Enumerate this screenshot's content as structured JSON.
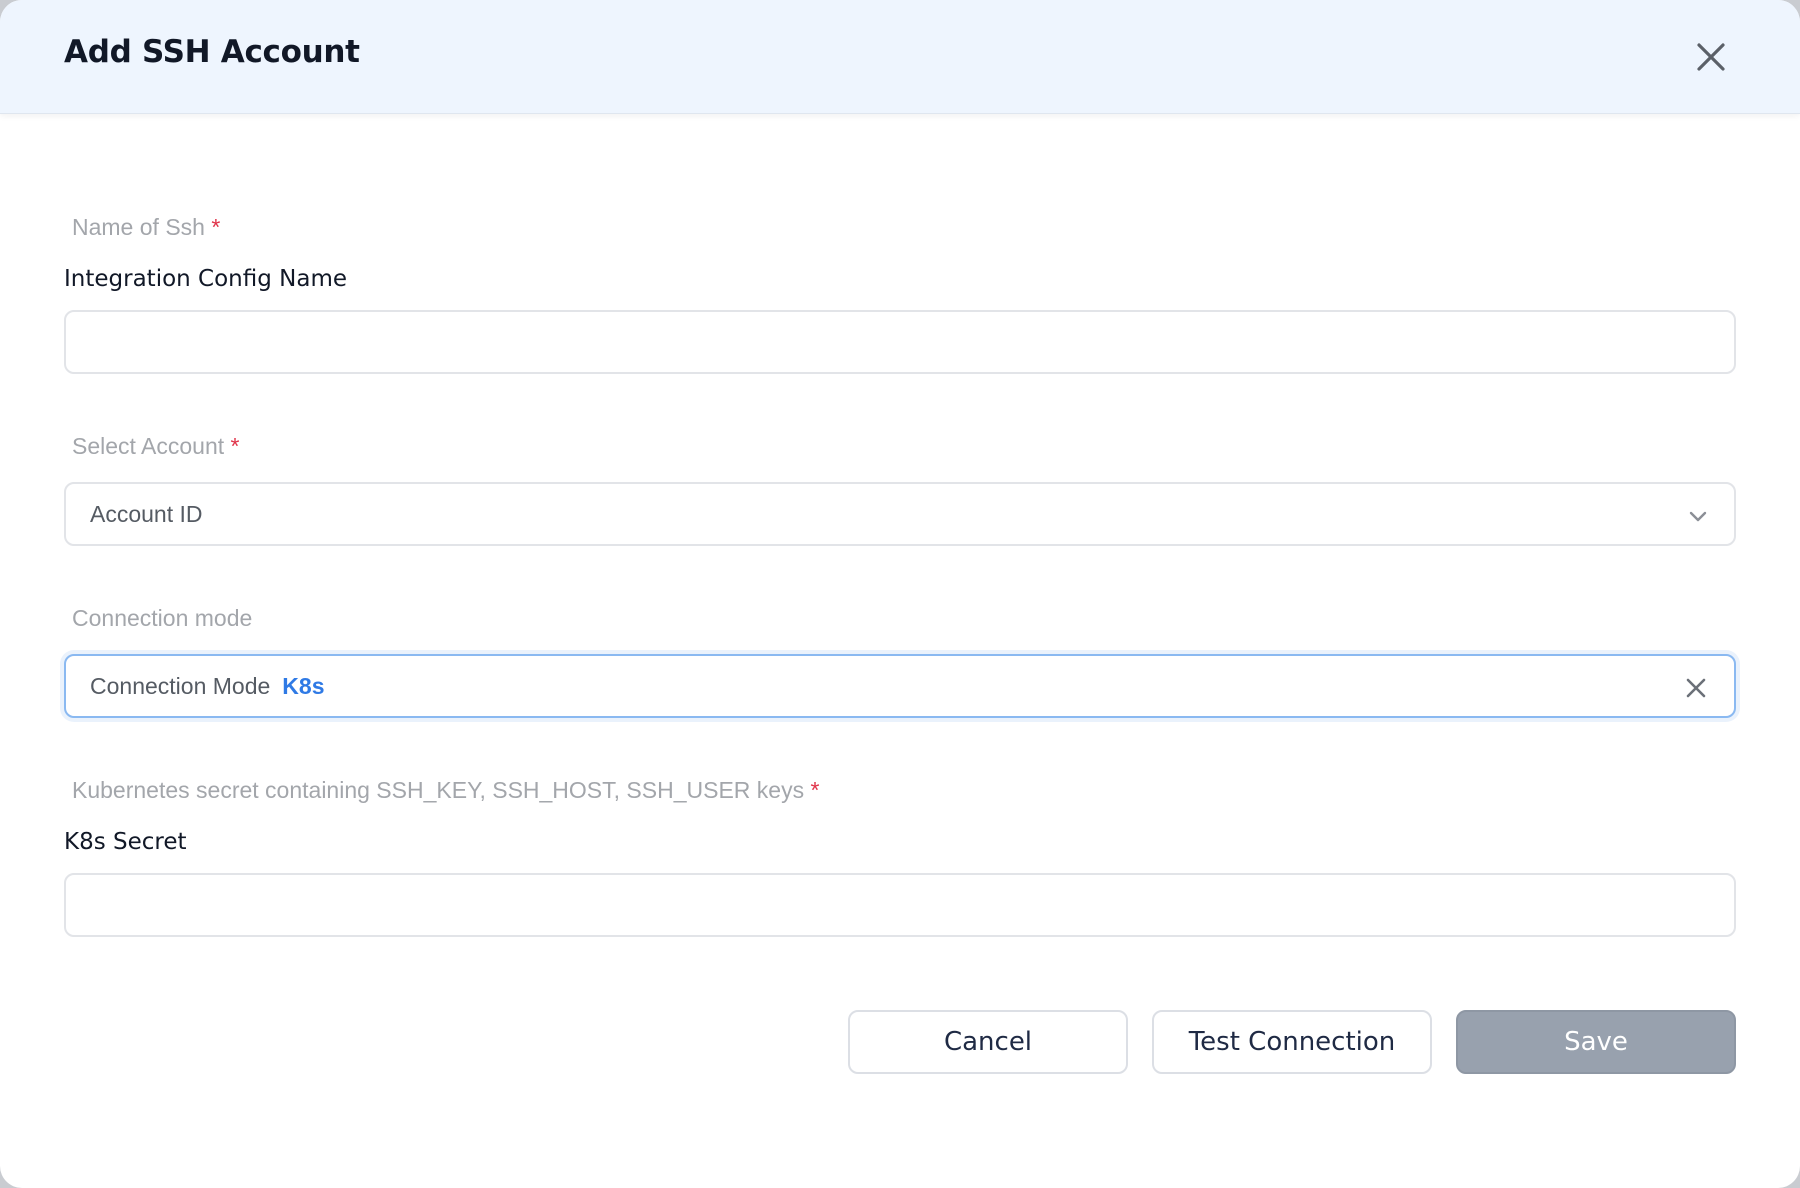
{
  "modal": {
    "title": "Add SSH Account"
  },
  "fields": {
    "name": {
      "caption": "Name of Ssh",
      "required_mark": "*",
      "label": "Integration Config Name",
      "value": "",
      "placeholder": ""
    },
    "account": {
      "caption": "Select Account",
      "required_mark": "*",
      "selected": "Account ID"
    },
    "connection_mode": {
      "caption": "Connection mode",
      "label_text": "Connection Mode",
      "selected_value": "K8s"
    },
    "k8s_secret": {
      "caption": "Kubernetes secret containing SSH_KEY, SSH_HOST, SSH_USER keys",
      "required_mark": "*",
      "label": "K8s Secret",
      "value": "",
      "placeholder": ""
    }
  },
  "buttons": {
    "cancel": "Cancel",
    "test_connection": "Test Connection",
    "save": "Save"
  },
  "icons": {
    "close": "close-icon",
    "chevron": "chevron-down-icon",
    "clear": "clear-icon"
  },
  "colors": {
    "header_bg": "#eef5fe",
    "required": "#e0344a",
    "accent": "#2f7ae5",
    "save_disabled": "#98a1ae"
  }
}
